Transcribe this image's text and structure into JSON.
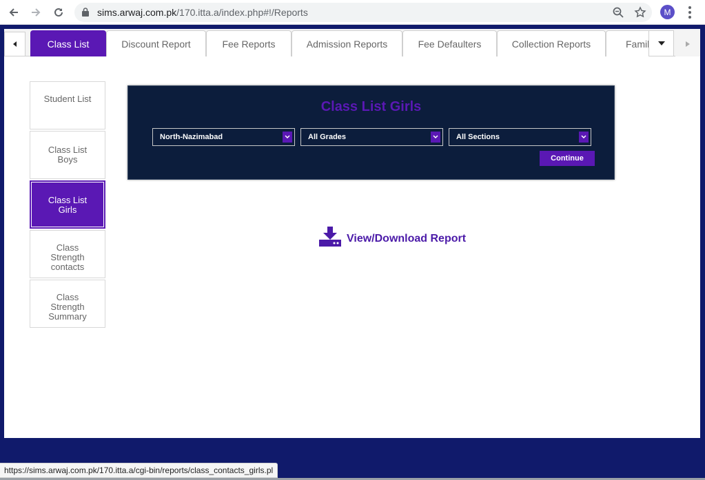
{
  "browser": {
    "url_host": "sims.arwaj.com.pk",
    "url_path": "/170.itta.a/index.php#!/Reports",
    "avatar_letter": "M"
  },
  "tabs": [
    {
      "label": "Class List",
      "active": true
    },
    {
      "label": "Discount Report",
      "active": false
    },
    {
      "label": "Fee Reports",
      "active": false
    },
    {
      "label": "Admission Reports",
      "active": false
    },
    {
      "label": "Fee Defaulters",
      "active": false
    },
    {
      "label": "Collection Reports",
      "active": false
    },
    {
      "label": "Family",
      "active": false
    }
  ],
  "sidebar": {
    "items": [
      {
        "label": "Student List",
        "active": false
      },
      {
        "label": "Class List Boys",
        "active": false
      },
      {
        "label": "Class List Girls",
        "active": true
      },
      {
        "label": "Class Strength contacts",
        "active": false
      },
      {
        "label": "Class Strength Summary",
        "active": false
      }
    ]
  },
  "panel": {
    "title": "Class List Girls",
    "campus_select": "North-Nazimabad",
    "grade_select": "All Grades",
    "section_select": "All Sections",
    "continue_label": "Continue"
  },
  "download": {
    "label": "View/Download Report"
  },
  "status": {
    "url": "https://sims.arwaj.com.pk/170.itta.a/cgi-bin/reports/class_contacts_girls.pl"
  },
  "colors": {
    "accent": "#5a18b4",
    "panel_bg": "#0c1d3c",
    "page_bg": "#101a6b"
  }
}
